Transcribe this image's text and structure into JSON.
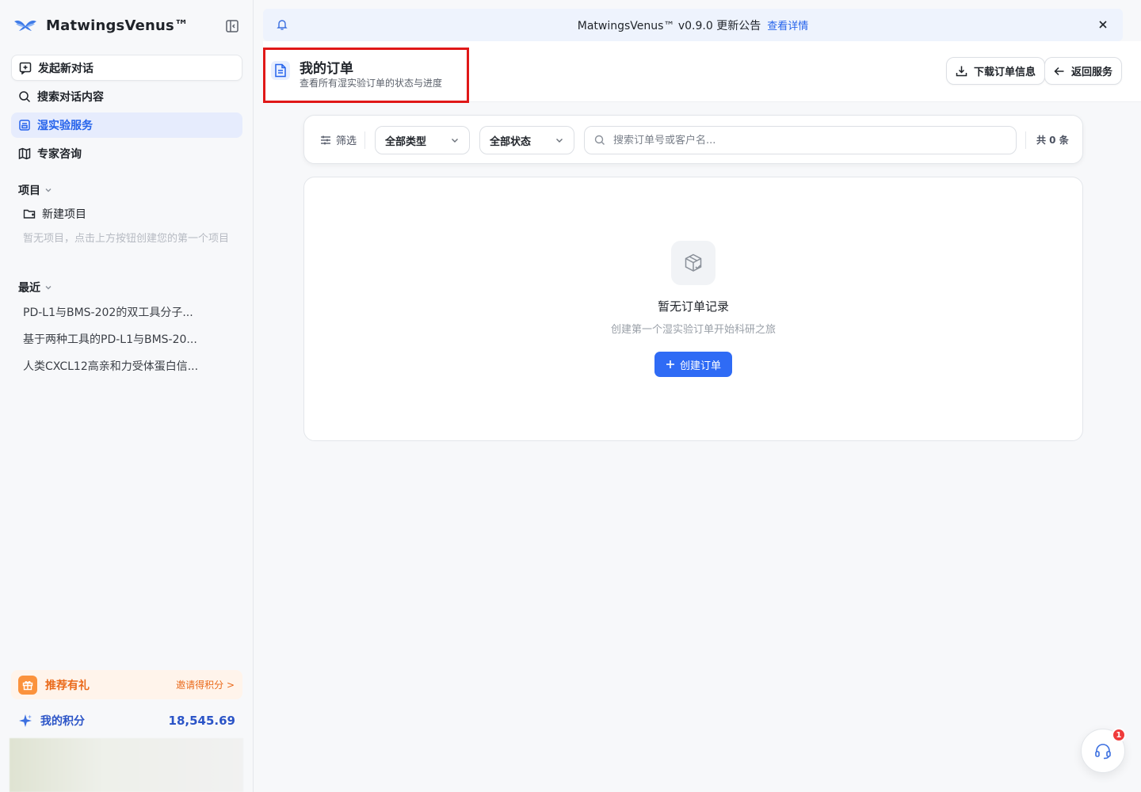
{
  "brand": {
    "name": "MatwingsVenus™"
  },
  "nav": [
    {
      "label": "发起新对话",
      "icon": "new-chat-icon"
    },
    {
      "label": "搜索对话内容",
      "icon": "search-icon"
    },
    {
      "label": "湿实验服务",
      "icon": "lab-service-icon"
    },
    {
      "label": "专家咨询",
      "icon": "map-icon"
    }
  ],
  "projects": {
    "heading": "项目",
    "new_label": "新建项目",
    "empty_text": "暂无项目，点击上方按钮创建您的第一个项目"
  },
  "recent": {
    "heading": "最近",
    "items": [
      "PD-L1与BMS-202的双工具分子...",
      "基于两种工具的PD-L1与BMS-20...",
      "人类CXCL12高亲和力受体蛋白信..."
    ]
  },
  "referral": {
    "title": "推荐有礼",
    "link": "邀请得积分 >"
  },
  "points": {
    "label": "我的积分",
    "value": "18,545.69"
  },
  "announcement": {
    "text": "MatwingsVenus™ v0.9.0 更新公告",
    "link": "查看详情"
  },
  "page": {
    "title": "我的订单",
    "subtitle": "查看所有湿实验订单的状态与进度",
    "download_label": "下载订单信息",
    "back_label": "返回服务"
  },
  "filters": {
    "label": "筛选",
    "type_select": "全部类型",
    "status_select": "全部状态",
    "search_placeholder": "搜索订单号或客户名...",
    "count": "共 0 条"
  },
  "empty": {
    "title": "暂无订单记录",
    "subtitle": "创建第一个湿实验订单开始科研之旅",
    "create_label": "创建订单"
  },
  "support": {
    "badge": "1"
  },
  "colors": {
    "accent": "#2563eb",
    "active_bg": "#e6ecfd",
    "referral": "#ea6a1b",
    "highlight_box": "#e01818"
  }
}
